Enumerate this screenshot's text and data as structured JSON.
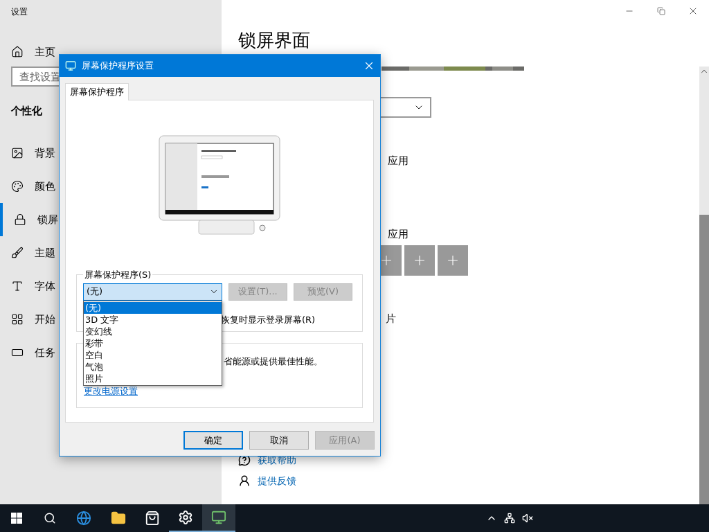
{
  "settings_window": {
    "title": "设置",
    "home": "主页",
    "search_placeholder": "查找设置",
    "section": "个性化",
    "nav": [
      {
        "label": "背景",
        "selected": false
      },
      {
        "label": "颜色",
        "selected": false
      },
      {
        "label": "锁屏",
        "selected": true
      },
      {
        "label": "主题",
        "selected": false
      },
      {
        "label": "字体",
        "selected": false
      },
      {
        "label": "开始",
        "selected": false
      },
      {
        "label": "任务",
        "selected": false
      }
    ],
    "page_title": "锁屏界面",
    "label_1": "应用",
    "label_2": "应用",
    "label_3": "片",
    "links": [
      {
        "label": "获取帮助",
        "kind": "help"
      },
      {
        "label": "提供反馈",
        "kind": "feedback"
      }
    ]
  },
  "dialog": {
    "title": "屏幕保护程序设置",
    "tabs": [
      {
        "label": "屏幕保护程序",
        "selected": true
      }
    ],
    "group_label": "屏幕保护程序(S)",
    "combo": {
      "value": "(无)",
      "expanded": true
    },
    "options": [
      {
        "label": "(无)",
        "selected": true
      },
      {
        "label": "3D 文字",
        "selected": false
      },
      {
        "label": "变幻线",
        "selected": false
      },
      {
        "label": "彩带",
        "selected": false
      },
      {
        "label": "空白",
        "selected": false
      },
      {
        "label": "气泡",
        "selected": false
      },
      {
        "label": "照片",
        "selected": false
      }
    ],
    "side_buttons": [
      {
        "label": "设置(T)...",
        "disabled": true
      },
      {
        "label": "预览(V)",
        "disabled": true
      }
    ],
    "checkbox_text": "恢复时显示登录屏幕(R)",
    "power_text": "省能源或提供最佳性能。",
    "power_link": "更改电源设置",
    "footer_buttons": [
      {
        "label": "确定",
        "kind": "default",
        "disabled": false
      },
      {
        "label": "取消",
        "kind": "normal",
        "disabled": false
      },
      {
        "label": "应用(A)",
        "kind": "normal",
        "disabled": true
      }
    ]
  }
}
